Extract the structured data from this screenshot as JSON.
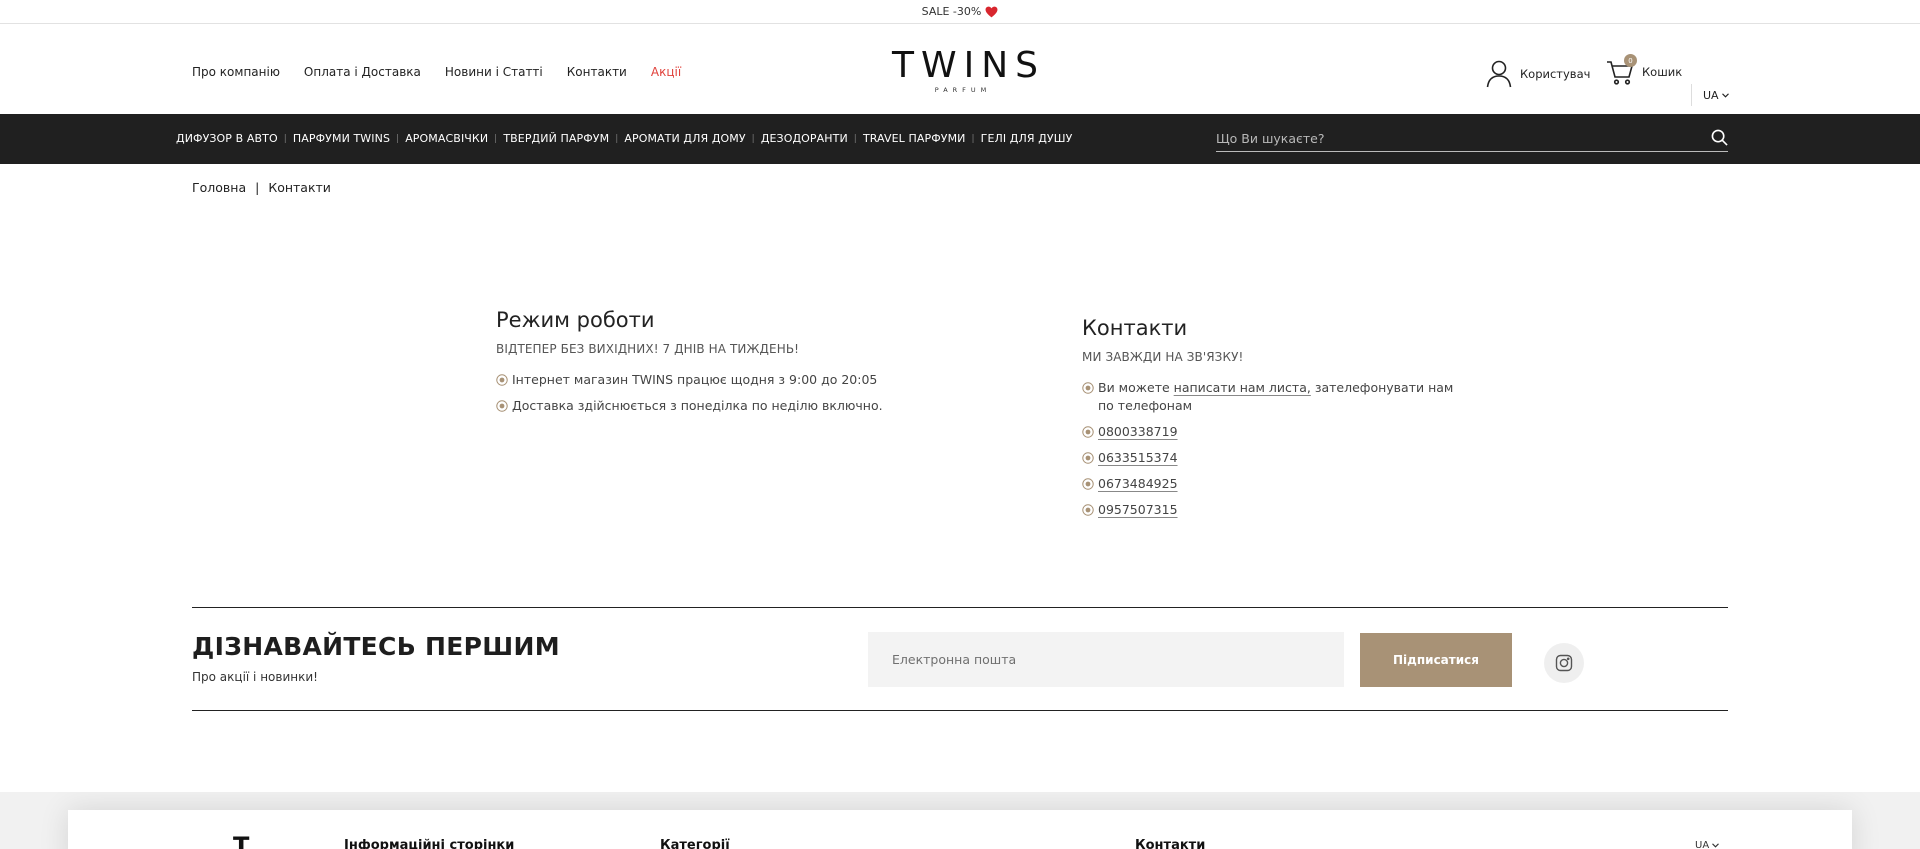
{
  "promo": {
    "text": "SALE -30%"
  },
  "topnav": [
    "Про компанію",
    "Оплата і Доставка",
    "Новини і Статті",
    "Контакти",
    "Акції"
  ],
  "logo": {
    "word": "TWINS",
    "sub": "PARFUM"
  },
  "user": {
    "label": "Користувач"
  },
  "cart": {
    "label": "Кошик",
    "count": "0"
  },
  "lang": "UA",
  "categories": [
    "ДИФУЗОР В АВТО",
    "ПАРФУМИ TWINS",
    "АРОМАСВІЧКИ",
    "ТВЕРДИЙ ПАРФУМ",
    "АРОМАТИ ДЛЯ ДОМУ",
    "ДЕЗОДОРАНТИ",
    "TRAVEL ПАРФУМИ",
    "ГЕЛІ ДЛЯ ДУШУ"
  ],
  "search": {
    "placeholder": "Що Ви шукаєте?"
  },
  "breadcrumb": {
    "home": "Головна",
    "sep": "|",
    "current": "Контакти"
  },
  "hours": {
    "title": "Режим роботи",
    "subtitle": "ВІДТЕПЕР БЕЗ ВИХІДНИХ! 7 ДНІВ НА ТИЖДЕНЬ!",
    "items": [
      "Інтернет магазин TWINS працює щодня з 9:00 до 20:05",
      "Доставка здійснюється з понеділка по неділю включно."
    ]
  },
  "contacts": {
    "title": "Контакти",
    "subtitle": "МИ ЗАВЖДИ НА ЗВ'ЯЗКУ!",
    "intro_before": "Ви можете ",
    "intro_link": "написати нам листа,",
    "intro_after": " зателефонувати нам по телефонам",
    "phones": [
      "0800338719",
      "0633515374",
      "0673484925",
      "0957507315"
    ]
  },
  "subscribe": {
    "title": "ДІЗНАВАЙТЕСЬ ПЕРШИМ",
    "text": "Про акції і новинки!",
    "email_placeholder": "Електронна пошта",
    "button": "Підписатися"
  },
  "footer": {
    "logo_letter": "T",
    "col1": "Інформаційні сторінки",
    "col2": "Категорії",
    "col3": "Контакти",
    "lang": "UA"
  },
  "colors": {
    "accent": "#a89276",
    "dark_bar": "#202020",
    "sale": "#e0413b",
    "heart": "#d8262e"
  }
}
